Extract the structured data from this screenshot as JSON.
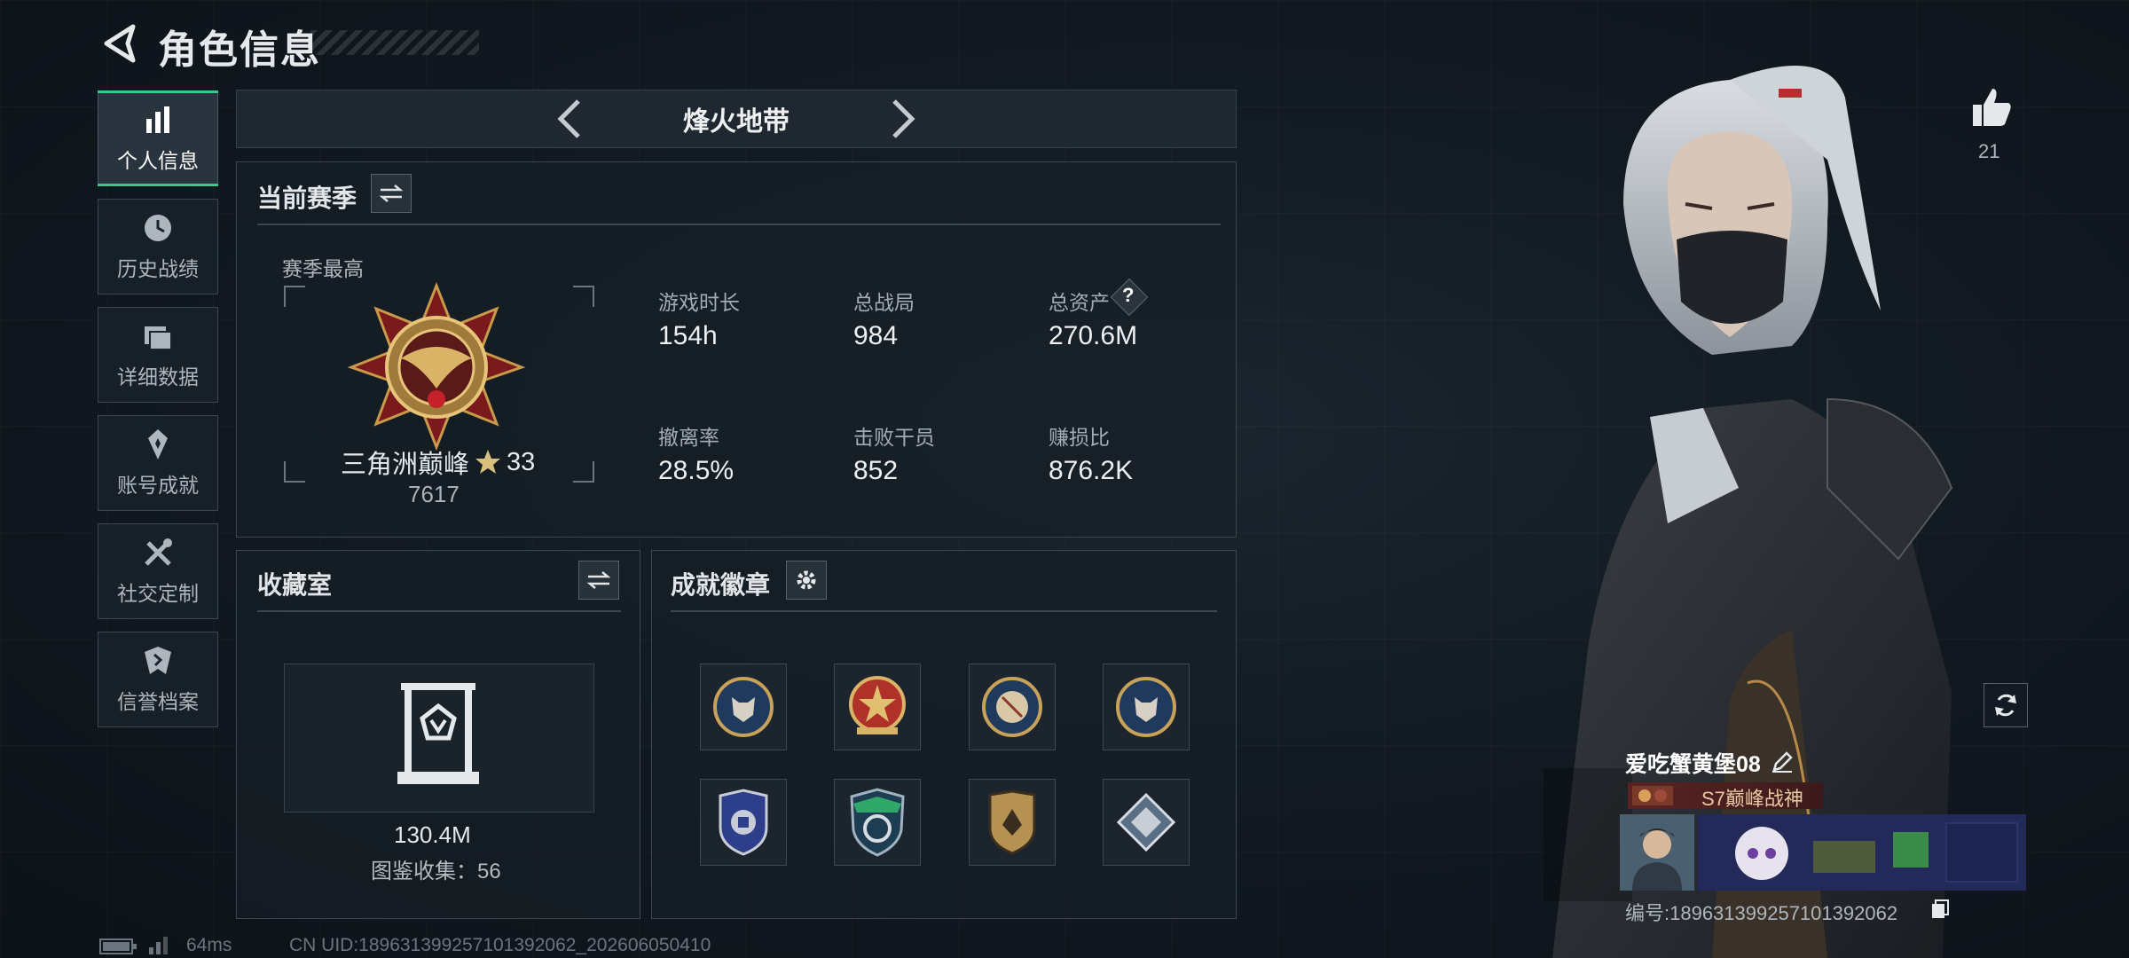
{
  "header": {
    "title": "角色信息"
  },
  "sidebar": {
    "items": [
      {
        "label": "个人信息",
        "icon": "bar-chart-icon",
        "active": true
      },
      {
        "label": "历史战绩",
        "icon": "history-clock-icon"
      },
      {
        "label": "详细数据",
        "icon": "folder-icon"
      },
      {
        "label": "账号成就",
        "icon": "achievement-icon"
      },
      {
        "label": "社交定制",
        "icon": "tools-icon"
      },
      {
        "label": "信誉档案",
        "icon": "shield-icon"
      }
    ]
  },
  "mode": {
    "title": "烽火地带"
  },
  "season": {
    "title": "当前赛季",
    "best_label": "赛季最高",
    "rank_name": "三角洲巅峰",
    "rank_stars": "33",
    "rank_score": "7617",
    "stats": [
      {
        "label": "游戏时长",
        "value": "154h"
      },
      {
        "label": "总战局",
        "value": "984"
      },
      {
        "label": "总资产",
        "value": "270.6M",
        "help": "?"
      },
      {
        "label": "撤离率",
        "value": "28.5%"
      },
      {
        "label": "击败干员",
        "value": "852"
      },
      {
        "label": "赚损比",
        "value": "876.2K"
      }
    ]
  },
  "collection": {
    "title": "收藏室",
    "value": "130.4M",
    "gallery_label": "图鉴收集：56"
  },
  "achievements": {
    "title": "成就徽章",
    "badges": [
      "wolf-medal-icon",
      "red-star-medal-icon",
      "baseball-medal-icon",
      "wolf-medal-icon",
      "police-shield-icon",
      "green-emblem-icon",
      "gold-shield-icon",
      "diamond-badge-icon"
    ]
  },
  "likes": {
    "count": "21"
  },
  "profile": {
    "name": "爱吃蟹黄堡08",
    "title": "S7巅峰战神",
    "id_text": "编号:18963139925710139206​2"
  },
  "footer": {
    "ping": "64ms",
    "uid": "CN UID:18963139925710139206​2_202606050410"
  },
  "colors": {
    "accent": "#36c98a",
    "panel_border": "#3b4651",
    "background": "#0f151c"
  }
}
